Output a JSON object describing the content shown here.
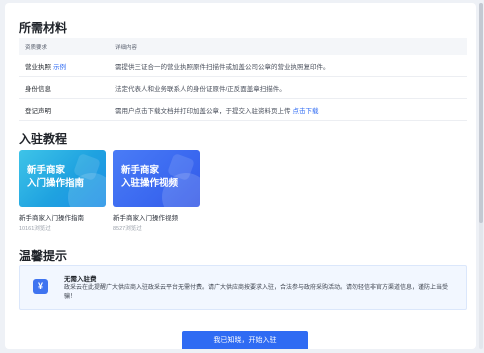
{
  "materials": {
    "title": "所需材料",
    "header": [
      "资质要求",
      "详细内容"
    ],
    "rows": [
      {
        "name": "营业执照",
        "link": "示例",
        "detail": "需提供三证合一的营业执照原件扫描件或加盖公司公章的营业执照复印件。",
        "detail_link": ""
      },
      {
        "name": "身份信息",
        "link": "",
        "detail": "法定代表人和业务联系人的身份证原件/正反面盖章扫描件。",
        "detail_link": ""
      },
      {
        "name": "登记声明",
        "link": "",
        "detail": "需用户点击下载文档并打印加盖公章，于提交入驻资料页上传",
        "detail_link": "点击下载"
      }
    ]
  },
  "tutorials": {
    "title": "入驻教程",
    "cards": [
      {
        "image_text_line1": "新手商家",
        "image_text_line2": "入门操作指南",
        "title": "新手商家入门操作指南",
        "meta": "10161浏览过"
      },
      {
        "image_text_line1": "新手商家",
        "image_text_line2": "入驻操作视频",
        "title": "新手商家入门操作视频",
        "meta": "8527浏览过"
      }
    ]
  },
  "tips": {
    "title": "温馨提示",
    "icon": "¥",
    "heading": "无需入驻费",
    "body": "政采云在此提醒广大供应商入驻政采云平台无需付费。请广大供应商按要求入驻，合法参与政府采购活动。请勿轻信非官方渠道信息，谨防上当受骗！"
  },
  "cta": {
    "label": "我已知晓，开始入驻"
  },
  "colors": {
    "accent": "#2f6bf3",
    "tip_bg": "#f2f7ff"
  }
}
